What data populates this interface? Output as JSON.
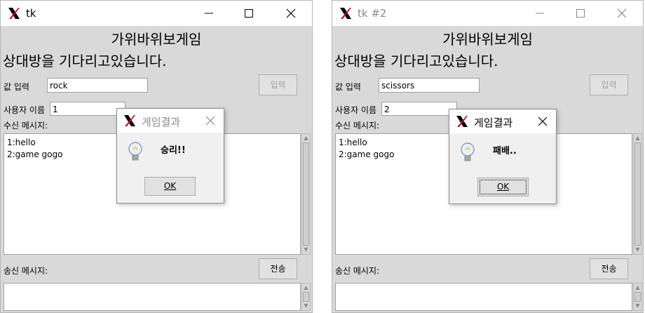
{
  "windows": [
    {
      "title": "tk",
      "heading": "가위바위보게임",
      "status": "상대방을 기다리고있습니다.",
      "value_label": "값 입력",
      "value_input": "rock",
      "submit_label": "입력",
      "username_label": "사용자 이름",
      "username_input": "1",
      "received_label": "수신 메시지:",
      "received_messages": [
        "1:hello",
        "2:game gogo"
      ],
      "send_label": "송신 메시지:",
      "send_button": "전송",
      "dialog": {
        "title": "게임결과",
        "message": "승리!!",
        "ok_label": "OK"
      }
    },
    {
      "title": "tk #2",
      "heading": "가위바위보게임",
      "status": "상대방을 기다리고있습니다.",
      "value_label": "값 입력",
      "value_input": "scissors",
      "submit_label": "입력",
      "username_label": "사용자 이름",
      "username_input": "2",
      "received_label": "수신 메시지:",
      "received_messages": [
        "1:hello",
        "2:game gogo"
      ],
      "send_label": "송신 메시지:",
      "send_button": "전송",
      "dialog": {
        "title": "게임결과",
        "message": "패배..",
        "ok_label": "OK"
      }
    }
  ],
  "icons": {
    "app": "tk-feather-x-icon",
    "minimize": "minimize-icon",
    "maximize": "maximize-icon",
    "close": "close-icon",
    "info": "lightbulb-icon",
    "scroll_up": "scroll-up-arrow-icon",
    "scroll_down": "scroll-down-arrow-icon"
  },
  "colors": {
    "window_bg": "#d9d9d9",
    "titlebar_bg": "#ffffff",
    "inactive_title": "#8a8a8a"
  }
}
